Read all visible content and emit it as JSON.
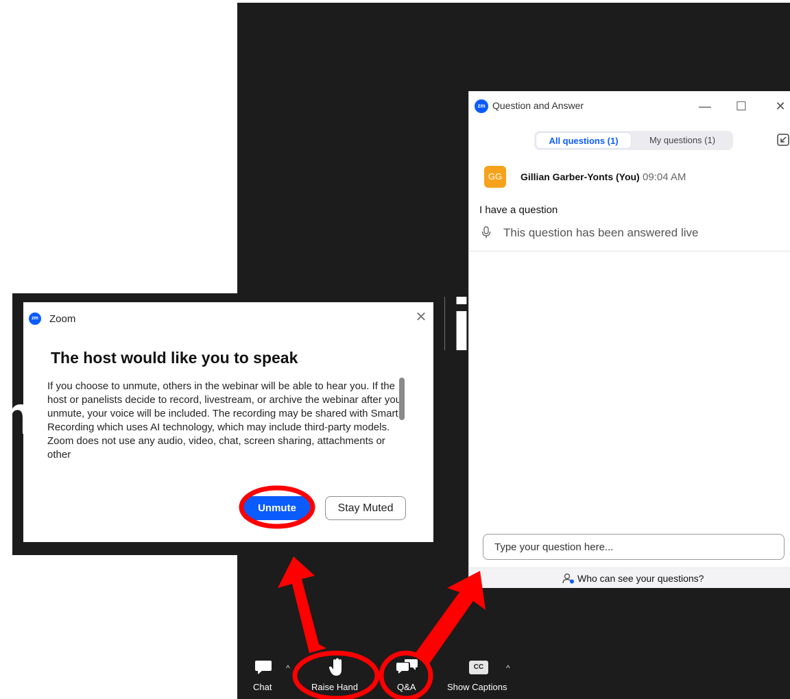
{
  "qa_window": {
    "title": "Question and Answer",
    "logo_text": "zm",
    "minimize_glyph": "—",
    "maximize_glyph": "☐",
    "close_glyph": "✕",
    "tabs": [
      {
        "label": "All questions (1)",
        "active": true
      },
      {
        "label": "My questions (1)",
        "active": false
      }
    ],
    "popout_icon": "popout-icon",
    "question": {
      "avatar_initials": "GG",
      "author": "Gillian Garber-Yonts (You)",
      "time": "09:04 AM",
      "text": "I have a question",
      "status": "This question has been answered live"
    },
    "input_placeholder": "Type your question here...",
    "footer_link": "Who can see your questions?"
  },
  "dialog": {
    "title": "Zoom",
    "logo_text": "zm",
    "close_glyph": "✕",
    "heading": "The host would like you to speak",
    "body": "If you choose to unmute, others in the webinar will be able to hear you. If the host or panelists decide to record, livestream, or archive the webinar after you unmute, your voice will be included. The recording may be shared with Smart Recording which uses AI technology, which may include third-party models. Zoom does not use any audio, video, chat, screen sharing, attachments or other",
    "unmute_label": "Unmute",
    "stay_muted_label": "Stay Muted"
  },
  "toolbar": {
    "chat": "Chat",
    "raise_hand": "Raise Hand",
    "qa": "Q&A",
    "captions": "Show Captions",
    "cc_badge": "CC",
    "caret": "^"
  },
  "background_glyphs": {
    "right": "li",
    "left": "n"
  },
  "colors": {
    "accent": "#0b5cff",
    "avatar": "#f7a21b",
    "annotation": "#ff0000",
    "meeting_bg": "#1c1c1c"
  }
}
